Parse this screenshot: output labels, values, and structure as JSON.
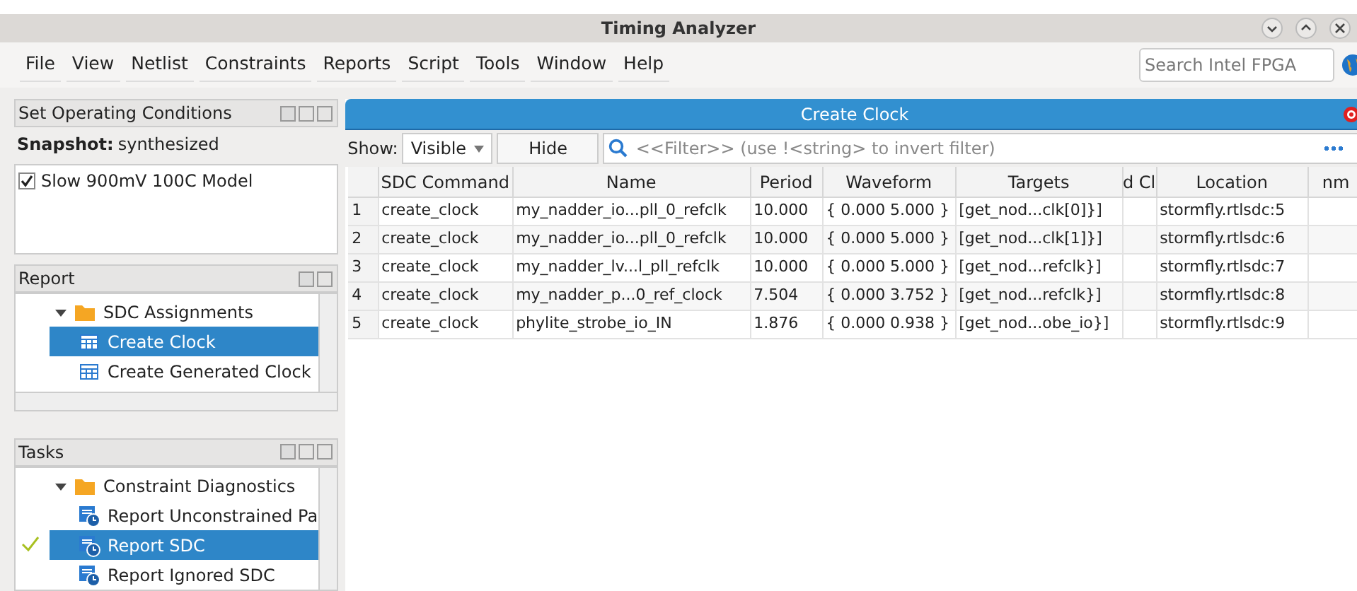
{
  "window": {
    "title": "Timing Analyzer"
  },
  "menu": [
    "File",
    "View",
    "Netlist",
    "Constraints",
    "Reports",
    "Script",
    "Tools",
    "Window",
    "Help"
  ],
  "search": {
    "placeholder": "Search Intel FPGA"
  },
  "operating_conditions": {
    "title": "Set Operating Conditions",
    "snapshot_label": "Snapshot:",
    "snapshot_value": "synthesized",
    "models": [
      {
        "label": "Slow 900mV 100C Model",
        "checked": true
      }
    ]
  },
  "report": {
    "title": "Report",
    "tree": [
      {
        "label": "SDC Assignments",
        "kind": "folder",
        "expanded": true,
        "selected": false,
        "children": [
          {
            "label": "Create Clock",
            "kind": "table",
            "selected": true
          },
          {
            "label": "Create Generated Clock",
            "kind": "table",
            "selected": false
          }
        ]
      }
    ]
  },
  "tasks": {
    "title": "Tasks",
    "tree": [
      {
        "label": "Constraint Diagnostics",
        "kind": "folder",
        "expanded": true,
        "selected": false,
        "done": false,
        "children": [
          {
            "label": "Report Unconstrained Pa",
            "kind": "task",
            "selected": false,
            "done": false
          },
          {
            "label": "Report SDC",
            "kind": "task",
            "selected": true,
            "done": true
          },
          {
            "label": "Report Ignored SDC",
            "kind": "task",
            "selected": false,
            "done": false
          }
        ]
      }
    ]
  },
  "main": {
    "title": "Create Clock",
    "show_label": "Show:",
    "show_value": "Visible",
    "hide_button": "Hide",
    "filter": {
      "placeholder": "<<Filter>> (use !<string> to invert filter)"
    },
    "table": {
      "columns": [
        "SDC Command",
        "Name",
        "Period",
        "Waveform",
        "Targets",
        "d Cl",
        "Location",
        "nm"
      ],
      "rows": [
        {
          "index": "1",
          "cells": [
            "create_clock",
            "my_nadder_io...pll_0_refclk",
            "10.000",
            "{ 0.000 5.000 }",
            "[get_nod...clk[0]}]",
            "",
            "stormfly.rtlsdc:5",
            ""
          ]
        },
        {
          "index": "2",
          "cells": [
            "create_clock",
            "my_nadder_io...pll_0_refclk",
            "10.000",
            "{ 0.000 5.000 }",
            "[get_nod...clk[1]}]",
            "",
            "stormfly.rtlsdc:6",
            ""
          ]
        },
        {
          "index": "3",
          "cells": [
            "create_clock",
            "my_nadder_lv...l_pll_refclk",
            "10.000",
            "{ 0.000 5.000 }",
            "[get_nod...refclk}]",
            "",
            "stormfly.rtlsdc:7",
            ""
          ]
        },
        {
          "index": "4",
          "cells": [
            "create_clock",
            "my_nadder_p...0_ref_clock",
            "7.504",
            "{ 0.000 3.752 }",
            "[get_nod...refclk}]",
            "",
            "stormfly.rtlsdc:8",
            ""
          ]
        },
        {
          "index": "5",
          "cells": [
            "create_clock",
            "phylite_strobe_io_IN",
            "1.876",
            "{ 0.000 0.938 }",
            "[get_nod...obe_io}]",
            "",
            "stormfly.rtlsdc:9",
            ""
          ]
        }
      ]
    }
  }
}
